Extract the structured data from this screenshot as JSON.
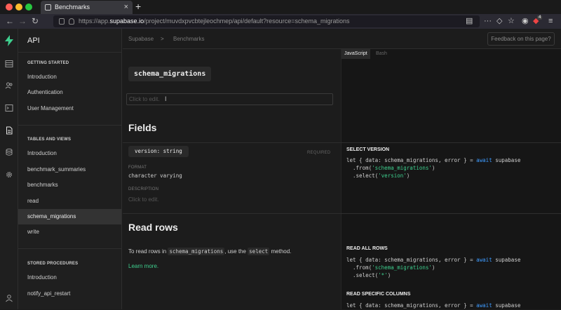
{
  "browser": {
    "tab_title": "Benchmarks",
    "url_prefix": "https://app.",
    "url_host": "supabase.io",
    "url_path": "/project/muvdxpvcbtejleochmep/api/default?resource=schema_migrations",
    "badge_count": "4",
    "colors": {
      "close": "#ff5f57",
      "minimize": "#febc2e",
      "maximize": "#28c840"
    }
  },
  "rail": {
    "logo": "supabase-logo",
    "items": [
      "table-editor-icon",
      "auth-users-icon",
      "sql-terminal-icon",
      "api-docs-icon",
      "database-icon",
      "settings-gear-icon"
    ],
    "bottom": "user-account-icon",
    "accent": "#3ecf8e"
  },
  "sidebar": {
    "title": "API",
    "sections": [
      {
        "heading": "GETTING STARTED",
        "items": [
          "Introduction",
          "Authentication",
          "User Management"
        ]
      },
      {
        "heading": "TABLES AND VIEWS",
        "items": [
          "Introduction",
          "benchmark_summaries",
          "benchmarks",
          "read",
          "schema_migrations",
          "write"
        ]
      },
      {
        "heading": "STORED PROCEDURES",
        "items": [
          "Introduction",
          "notify_api_restart"
        ]
      }
    ],
    "active_item": "schema_migrations"
  },
  "topbar": {
    "breadcrumb": [
      "Supabase",
      "Benchmarks"
    ],
    "separator": ">",
    "feedback_label": "Feedback on this page?"
  },
  "code_tabs": [
    "JavaScript",
    "Bash"
  ],
  "resource": {
    "name": "schema_migrations",
    "description_placeholder": "Click to edit."
  },
  "fields": {
    "title": "Fields",
    "column": "version: string",
    "required_label": "REQUIRED",
    "format_label": "FORMAT",
    "format_value": "character varying",
    "description_label": "DESCRIPTION",
    "description_placeholder": "Click to edit."
  },
  "read_rows": {
    "title": "Read rows",
    "text_before": "To read rows in",
    "table_code": "schema_migrations",
    "text_middle": ", use the",
    "method_code": "select",
    "text_after": "method.",
    "learn_more": "Learn more."
  },
  "snippets": {
    "select_version": {
      "title": "SELECT VERSION",
      "line1_a": "let { data: schema_migrations, error } = ",
      "line1_kw": "await",
      "line1_b": " supabase",
      "line2_a": "  .from(",
      "line2_str": "'schema_migrations'",
      "line2_b": ")",
      "line3_a": "  .select(",
      "line3_str": "'version'",
      "line3_b": ")"
    },
    "read_all": {
      "title": "READ ALL ROWS",
      "line1_a": "let { data: schema_migrations, error } = ",
      "line1_kw": "await",
      "line1_b": " supabase",
      "line2_a": "  .from(",
      "line2_str": "'schema_migrations'",
      "line2_b": ")",
      "line3_a": "  .select(",
      "line3_str": "'*'",
      "line3_b": ")"
    },
    "read_specific": {
      "title": "READ SPECIFIC COLUMNS",
      "line1_a": "let { data: schema_migrations, error } = ",
      "line1_kw": "await",
      "line1_b": " supabase"
    }
  }
}
